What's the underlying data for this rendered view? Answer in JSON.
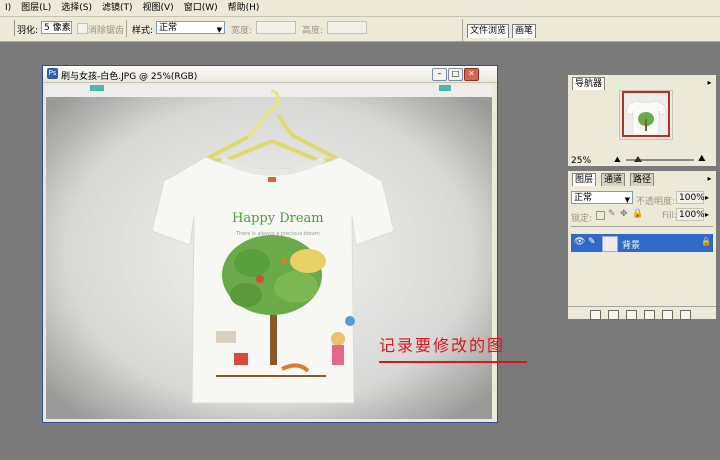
{
  "menubar": {
    "items": [
      "I)",
      "图层(L)",
      "选择(S)",
      "滤镜(T)",
      "视图(V)",
      "窗口(W)",
      "帮助(H)"
    ]
  },
  "options": {
    "feather_label": "羽化:",
    "feather_value": "5 像素",
    "antialias_label": "消除锯齿",
    "style_label": "样式:",
    "style_value": "正常",
    "width_label": "宽度:",
    "height_label": "高度:"
  },
  "palette_well": {
    "tabs": [
      "文件浏览",
      "画笔"
    ]
  },
  "document": {
    "title": "刷与女孩-白色.JPG @ 25%(RGB)",
    "annotation": "记录要修改的图"
  },
  "navigator": {
    "tab": "导航器",
    "zoom": "25%"
  },
  "layers_panel": {
    "tabs": [
      "图层",
      "通道",
      "路径"
    ],
    "blend_mode": "正常",
    "opacity_label": "不透明度:",
    "opacity_value": "100%",
    "lock_label": "锁定:",
    "fill_label": "Fill:",
    "fill_value": "100%",
    "layer_name": "背景"
  },
  "colors": {
    "annotation": "#e0151a",
    "selection": "#3169c6",
    "workspace": "#7a7a7a",
    "chrome": "#ece9d8"
  }
}
